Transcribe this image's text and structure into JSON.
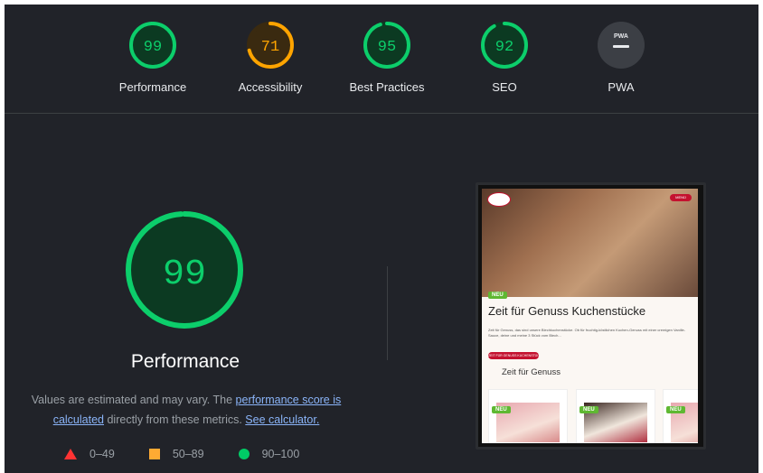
{
  "categories": [
    {
      "label": "Performance",
      "score": "99",
      "value": 99,
      "status": "pass"
    },
    {
      "label": "Accessibility",
      "score": "71",
      "value": 71,
      "status": "average"
    },
    {
      "label": "Best Practices",
      "score": "95",
      "value": 95,
      "status": "pass"
    },
    {
      "label": "SEO",
      "score": "92",
      "value": 92,
      "status": "pass"
    },
    {
      "label": "PWA",
      "score": "",
      "value": null,
      "status": "na",
      "badge_text": "PWA"
    }
  ],
  "main": {
    "score": "99",
    "value": 99,
    "title": "Performance",
    "desc_prefix": "Values are estimated and may vary. The ",
    "desc_link1": "performance score is calculated",
    "desc_middle": " directly from these metrics. ",
    "desc_link2": "See calculator."
  },
  "legend": [
    {
      "range": "0–49",
      "shape": "triangle",
      "color": "#ff3333"
    },
    {
      "range": "50–89",
      "shape": "square",
      "color": "#ffaa33"
    },
    {
      "range": "90–100",
      "shape": "circle",
      "color": "#00cc66"
    }
  ],
  "screenshot": {
    "menu_label": "MENÜ",
    "badge_new": "NEU",
    "title": "Zeit für Genuss Kuchenstücke",
    "body": "Zeit für Genuss, das sind unsere Blechkuchenstücke. Ob für fruchtig-köstlichen Kuchen-Genuss mit einer cremigen Vanille-Sauce, deine und meine 3 Stück vom Blech...",
    "button_label": "ZEIT FÜR GENUSS KUCHENSTÜCKE",
    "subtitle": "Zeit für Genuss"
  },
  "colors": {
    "pass": "#0cce6b",
    "average": "#ffa400",
    "fail": "#ff4e42",
    "background": "#212329"
  }
}
